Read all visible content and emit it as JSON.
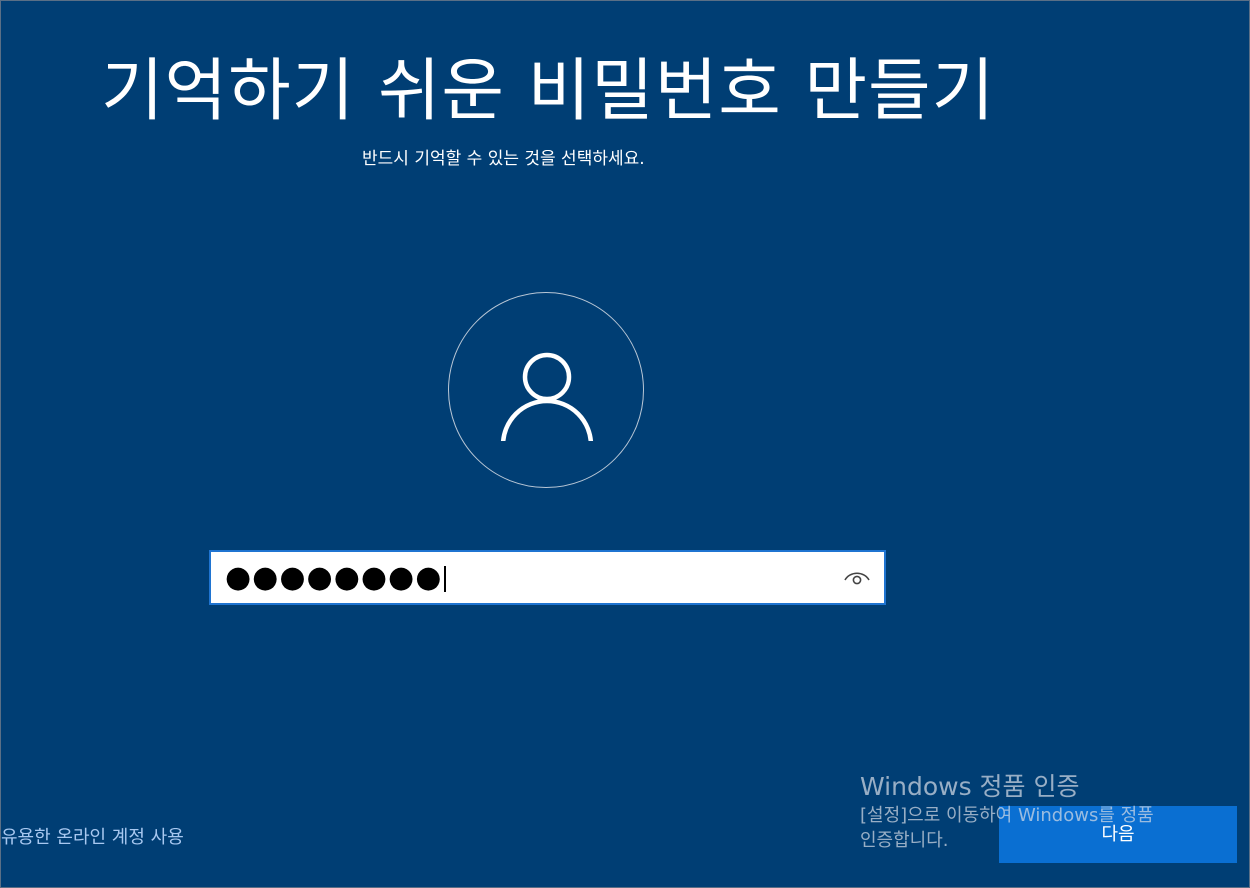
{
  "header": {
    "title": "기억하기 쉬운 비밀번호 만들기",
    "subtitle": "반드시 기억할 수 있는 것을 선택하세요."
  },
  "avatar": {
    "icon": "user-icon"
  },
  "password": {
    "masked_value": "●●●●●●●●",
    "reveal_icon": "eye-icon"
  },
  "footer": {
    "alt_account_link": "유용한 온라인 계정 사용",
    "next_button": "다음"
  },
  "watermark": {
    "title": "Windows 정품 인증",
    "line1": "[설정]으로 이동하여 Windows를 정품",
    "line2": "인증합니다."
  },
  "colors": {
    "background": "#003e74",
    "accent": "#0a6fd2",
    "input_border": "#1f74d1"
  }
}
